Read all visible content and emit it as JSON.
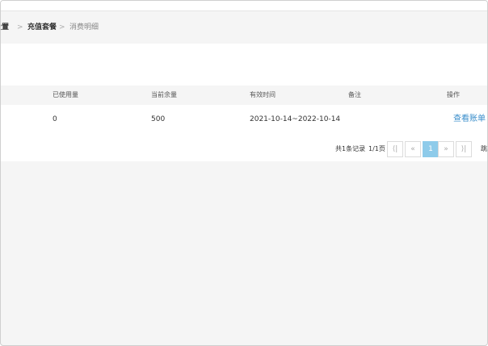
{
  "breadcrumb": {
    "first": "设置",
    "second": "充值套餐",
    "third": "消费明细",
    "sep": ">"
  },
  "table": {
    "headers": [
      "已使用量",
      "当前余量",
      "有效时间",
      "备注",
      "操作"
    ],
    "rows": [
      {
        "used": "0",
        "remain": "500",
        "period": "2021-10-14~2022-10-14",
        "note": "",
        "action": "查看账单"
      }
    ]
  },
  "pager": {
    "total": "共1条记录",
    "pages": "1/1页",
    "first": "⟨|",
    "prev": "«",
    "current": "1",
    "next": "»",
    "last": "⟩|",
    "cut_text": "跳"
  },
  "colors": {
    "link": "#3a8ecb",
    "active_page": "#8ecbea"
  }
}
